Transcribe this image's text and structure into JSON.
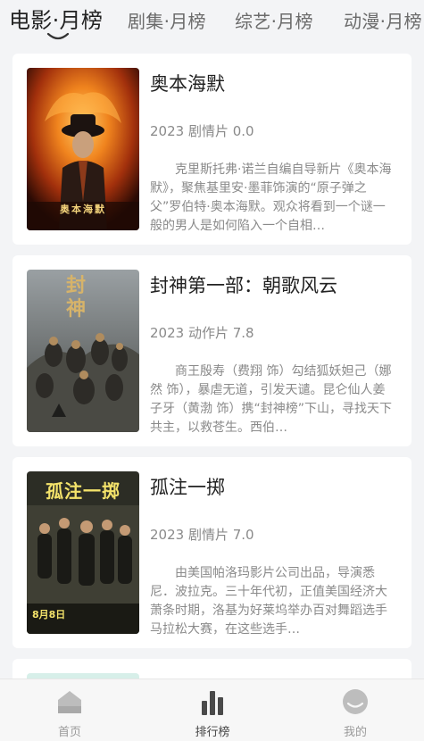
{
  "tabs": [
    {
      "label": "电影·月榜",
      "active": true
    },
    {
      "label": "剧集·月榜",
      "active": false
    },
    {
      "label": "综艺·月榜",
      "active": false
    },
    {
      "label": "动漫·月榜",
      "active": false
    }
  ],
  "movies": [
    {
      "title": "奥本海默",
      "meta": "2023 剧情片 0.0",
      "description": "克里斯托弗·诺兰自编自导新片《奥本海默》，聚焦基里安·墨菲饰演的“原子弹之父”罗伯特·奥本海默。观众将看到一个谜一般的男人是如何陷入一个自相…",
      "poster_text": "奥本海默"
    },
    {
      "title": "封神第一部：朝歌风云",
      "meta": "2023 动作片 7.8",
      "description": "商王殷寿（费翔 饰）勾结狐妖妲己（娜然 饰），暴虐无道，引发天谴。昆仑仙人姜子牙（黄渤 饰）携“封神榜”下山，寻找天下共主，以救苍生。西伯…",
      "poster_text": "封神"
    },
    {
      "title": "孤注一掷",
      "meta": "2023 剧情片 7.0",
      "description": "由美国帕洛玛影片公司出品，导演悉尼．波拉克。三十年代初，正值美国经济大萧条时期，洛基为好莱坞举办百对舞蹈选手马拉松大赛，在这些选手…",
      "poster_text": "孤注一掷",
      "poster_date": "8月8日"
    }
  ],
  "bottom_nav": [
    {
      "label": "首页",
      "icon": "home-icon",
      "active": false
    },
    {
      "label": "排行榜",
      "icon": "chart-icon",
      "active": true
    },
    {
      "label": "我的",
      "icon": "profile-icon",
      "active": false
    }
  ],
  "colors": {
    "background": "#f3f4f6",
    "card": "#ffffff",
    "title": "#222222",
    "muted": "#8a8a8a"
  }
}
